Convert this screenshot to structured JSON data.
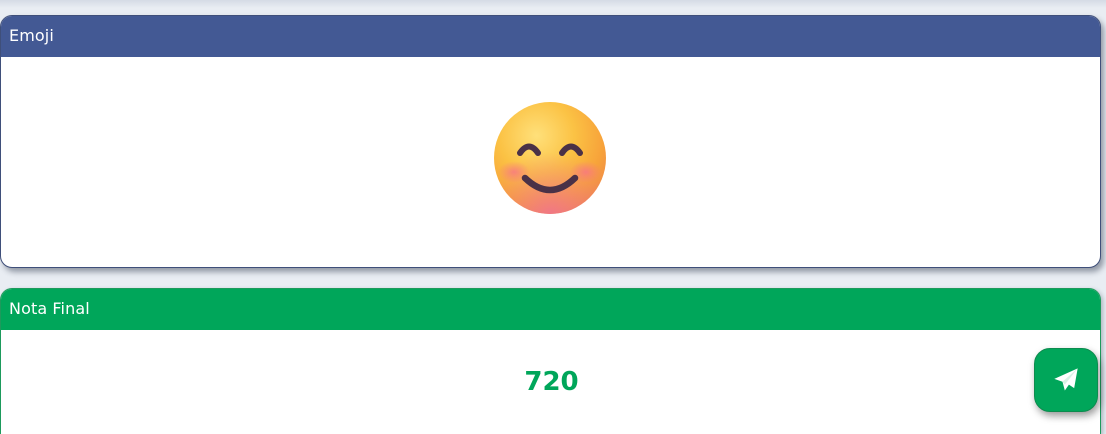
{
  "emoji_card": {
    "header": "Emoji",
    "emoji_icon": "smiling-face-with-smiling-eyes-icon"
  },
  "nota_card": {
    "header": "Nota Final",
    "score": "720"
  },
  "fab": {
    "icon": "paper-plane-icon"
  },
  "colors": {
    "emoji_header": "#435994",
    "nota_header": "#00a65a",
    "score_text": "#00a65a",
    "fab_background": "#00a65a"
  }
}
